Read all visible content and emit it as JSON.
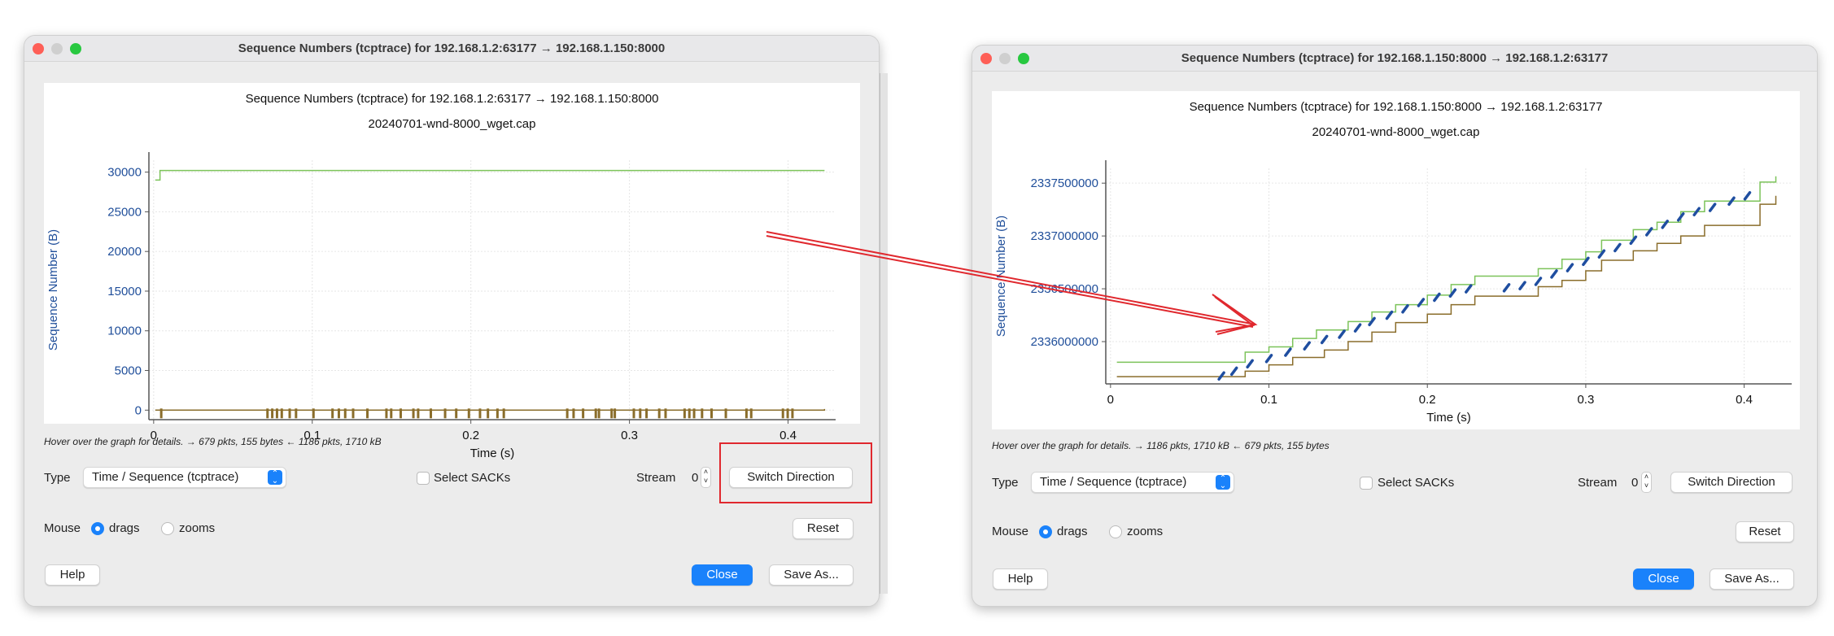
{
  "left_window": {
    "title": "Sequence Numbers (tcptrace) for 192.168.1.2:63177 → 192.168.1.150:8000",
    "plot_title": "Sequence Numbers (tcptrace) for 192.168.1.2:63177 → 192.168.1.150:8000",
    "plot_subtitle": "20240701-wnd-8000_wget.cap",
    "hover_text": "Hover over the graph for details. → 679 pkts, 155 bytes ← 1186 pkts, 1710 kB",
    "type_label": "Type",
    "type_value": "Time / Sequence (tcptrace)",
    "select_sacks": "Select SACKs",
    "select_sacks_checked": false,
    "stream_label": "Stream",
    "stream_value": "0",
    "switch_direction": "Switch Direction",
    "mouse_label": "Mouse",
    "mouse_drags": "drags",
    "mouse_zooms": "zooms",
    "mouse_selected": "drags",
    "reset": "Reset",
    "help": "Help",
    "close": "Close",
    "save_as": "Save As..."
  },
  "right_window": {
    "title": "Sequence Numbers (tcptrace) for 192.168.1.150:8000 → 192.168.1.2:63177",
    "plot_title": "Sequence Numbers (tcptrace) for 192.168.1.150:8000 → 192.168.1.2:63177",
    "plot_subtitle": "20240701-wnd-8000_wget.cap",
    "hover_text": "Hover over the graph for details. → 1186 pkts, 1710 kB ← 679 pkts, 155 bytes",
    "type_label": "Type",
    "type_value": "Time / Sequence (tcptrace)",
    "select_sacks": "Select SACKs",
    "select_sacks_checked": false,
    "stream_label": "Stream",
    "stream_value": "0",
    "switch_direction": "Switch Direction",
    "mouse_label": "Mouse",
    "mouse_drags": "drags",
    "mouse_zooms": "zooms",
    "mouse_selected": "drags",
    "reset": "Reset",
    "help": "Help",
    "close": "Close",
    "save_as": "Save As..."
  },
  "colors": {
    "accent": "#1a82fb",
    "annotation": "#e0282e",
    "window_line": "#7cc35a",
    "ack_line": "#8a6d2b",
    "segments": "#1f4ea0",
    "axis_label": "#1f4e9a"
  },
  "chart_data": [
    {
      "type": "line",
      "xlabel": "Time (s)",
      "ylabel": "Sequence Number (B)",
      "xlim": [
        -0.003,
        0.43
      ],
      "ylim": [
        -1200,
        31500
      ],
      "xticks": [
        0,
        0.1,
        0.2,
        0.3,
        0.4
      ],
      "xtick_labels": [
        "0",
        "0.1",
        "0.2",
        "0.3",
        "0.4"
      ],
      "yticks": [
        0,
        5000,
        10000,
        15000,
        20000,
        25000,
        30000
      ],
      "ytick_labels": [
        "0",
        "5000",
        "10000",
        "15000",
        "20000",
        "25000",
        "30000"
      ],
      "grid": true,
      "window": [
        [
          0.001,
          29000
        ],
        [
          0.004,
          29000
        ],
        [
          0.004,
          30200
        ],
        [
          0.423,
          30200
        ]
      ],
      "ack": [
        [
          0.001,
          0
        ],
        [
          0.423,
          150
        ]
      ],
      "segment_times": [
        0.004,
        0.071,
        0.074,
        0.077,
        0.08,
        0.085,
        0.089,
        0.1,
        0.112,
        0.116,
        0.12,
        0.125,
        0.134,
        0.146,
        0.149,
        0.155,
        0.163,
        0.166,
        0.174,
        0.183,
        0.19,
        0.198,
        0.205,
        0.21,
        0.216,
        0.22,
        0.26,
        0.264,
        0.27,
        0.278,
        0.28,
        0.288,
        0.29,
        0.302,
        0.306,
        0.31,
        0.318,
        0.322,
        0.334,
        0.337,
        0.34,
        0.345,
        0.351,
        0.36,
        0.373,
        0.376,
        0.396,
        0.399,
        0.402
      ]
    },
    {
      "type": "line",
      "xlabel": "Time (s)",
      "ylabel": "Sequence Number (B)",
      "xlim": [
        -0.003,
        0.43
      ],
      "ylim": [
        2335600000,
        2337640000
      ],
      "xticks": [
        0,
        0.1,
        0.2,
        0.3,
        0.4
      ],
      "xtick_labels": [
        "0",
        "0.1",
        "0.2",
        "0.3",
        "0.4"
      ],
      "yticks": [
        2336000000,
        2336500000,
        2337000000,
        2337500000
      ],
      "ytick_labels": [
        "2336000000",
        "2336500000",
        "2337000000",
        "2337500000"
      ],
      "grid": true,
      "window": [
        [
          0.004,
          2335805000
        ],
        [
          0.07,
          2335805000
        ],
        [
          0.085,
          2335900000
        ],
        [
          0.1,
          2335950000
        ],
        [
          0.115,
          2336030000
        ],
        [
          0.13,
          2336110000
        ],
        [
          0.15,
          2336190000
        ],
        [
          0.165,
          2336280000
        ],
        [
          0.18,
          2336350000
        ],
        [
          0.2,
          2336440000
        ],
        [
          0.215,
          2336540000
        ],
        [
          0.23,
          2336620000
        ],
        [
          0.26,
          2336620000
        ],
        [
          0.27,
          2336690000
        ],
        [
          0.285,
          2336780000
        ],
        [
          0.3,
          2336850000
        ],
        [
          0.31,
          2336960000
        ],
        [
          0.33,
          2337060000
        ],
        [
          0.345,
          2337130000
        ],
        [
          0.36,
          2337230000
        ],
        [
          0.375,
          2337330000
        ],
        [
          0.4,
          2337330000
        ],
        [
          0.41,
          2337510000
        ],
        [
          0.42,
          2337565000
        ]
      ],
      "ack": [
        [
          0.004,
          2335668000
        ],
        [
          0.068,
          2335668000
        ],
        [
          0.085,
          2335720000
        ],
        [
          0.1,
          2335780000
        ],
        [
          0.115,
          2335850000
        ],
        [
          0.135,
          2335920000
        ],
        [
          0.15,
          2336000000
        ],
        [
          0.165,
          2336090000
        ],
        [
          0.18,
          2336180000
        ],
        [
          0.2,
          2336260000
        ],
        [
          0.215,
          2336350000
        ],
        [
          0.23,
          2336430000
        ],
        [
          0.26,
          2336430000
        ],
        [
          0.27,
          2336520000
        ],
        [
          0.285,
          2336580000
        ],
        [
          0.3,
          2336670000
        ],
        [
          0.31,
          2336770000
        ],
        [
          0.33,
          2336860000
        ],
        [
          0.345,
          2336930000
        ],
        [
          0.36,
          2337000000
        ],
        [
          0.375,
          2337100000
        ],
        [
          0.4,
          2337100000
        ],
        [
          0.41,
          2337300000
        ],
        [
          0.42,
          2337380000
        ]
      ],
      "segments": [
        [
          0.07,
          2335675000
        ],
        [
          0.078,
          2335720000
        ],
        [
          0.088,
          2335790000
        ],
        [
          0.1,
          2335840000
        ],
        [
          0.112,
          2335900000
        ],
        [
          0.124,
          2335960000
        ],
        [
          0.135,
          2336020000
        ],
        [
          0.146,
          2336070000
        ],
        [
          0.156,
          2336130000
        ],
        [
          0.165,
          2336190000
        ],
        [
          0.176,
          2336250000
        ],
        [
          0.186,
          2336310000
        ],
        [
          0.196,
          2336370000
        ],
        [
          0.206,
          2336420000
        ],
        [
          0.216,
          2336460000
        ],
        [
          0.226,
          2336500000
        ],
        [
          0.25,
          2336510000
        ],
        [
          0.26,
          2336530000
        ],
        [
          0.27,
          2336570000
        ],
        [
          0.28,
          2336640000
        ],
        [
          0.29,
          2336700000
        ],
        [
          0.3,
          2336760000
        ],
        [
          0.31,
          2336830000
        ],
        [
          0.32,
          2336890000
        ],
        [
          0.33,
          2336960000
        ],
        [
          0.34,
          2337040000
        ],
        [
          0.35,
          2337110000
        ],
        [
          0.36,
          2337180000
        ],
        [
          0.37,
          2337230000
        ],
        [
          0.38,
          2337270000
        ],
        [
          0.392,
          2337330000
        ],
        [
          0.402,
          2337380000
        ]
      ]
    }
  ]
}
